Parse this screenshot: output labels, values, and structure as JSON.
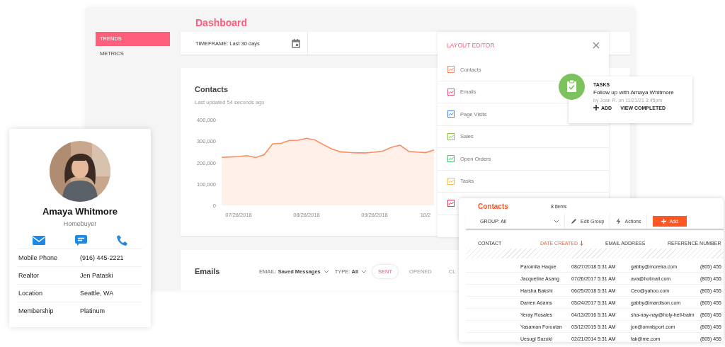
{
  "window": {
    "title": "Dashboard"
  },
  "sidebar": {
    "items": [
      {
        "label": "TRENDS",
        "selected": true
      },
      {
        "label": "METRICS",
        "selected": false
      }
    ]
  },
  "toolbar": {
    "timeframe": "TIMEFRAME: Last 30 days"
  },
  "contacts_card": {
    "title": "Contacts",
    "subtitle": "Last updated 54 seconds ago",
    "chart_data": {
      "type": "area",
      "categories": [
        null,
        null,
        "07/28/2018",
        null,
        null,
        null,
        null,
        null,
        null,
        null,
        "08/28/2018",
        null,
        null,
        null,
        null,
        null,
        null,
        null,
        "09/28/2018",
        null,
        null,
        null,
        null,
        null,
        "10/2",
        null
      ],
      "series": [
        {
          "color": "#ff8a5c",
          "values": [
            224000,
            226000,
            228000,
            232000,
            223000,
            236000,
            287000,
            290000,
            303000,
            304000,
            313000,
            305000,
            283000,
            263000,
            250000,
            247000,
            245000,
            245000,
            249000,
            254000,
            271000,
            281000,
            253000,
            249000,
            246000,
            259000
          ]
        }
      ],
      "ylim": [
        0,
        400000
      ],
      "yticks": [
        {
          "value": 0,
          "label": "0"
        },
        {
          "value": 100000,
          "label": "100,000"
        },
        {
          "value": 200000,
          "label": "200,000"
        },
        {
          "value": 300000,
          "label": "300,000"
        },
        {
          "value": 400000,
          "label": "400,000"
        }
      ]
    }
  },
  "emails_card": {
    "title": "Emails",
    "filters": [
      "EMAIL: **Saved Messages**",
      "TYPE: **All**"
    ],
    "tabs": [
      {
        "label": "SENT",
        "selected": true
      },
      {
        "label": "OPENED",
        "selected": false
      },
      {
        "label": "CL",
        "selected": false
      }
    ]
  },
  "layout_editor": {
    "title": "LAYOUT EDITOR",
    "items": [
      {
        "label": "Contacts",
        "color": "#ff8a65"
      },
      {
        "label": "Emails",
        "color": "#ef5370"
      },
      {
        "label": "Page Visits",
        "color": "#4a86e8"
      },
      {
        "label": "Sales",
        "color": "#8bc34a"
      },
      {
        "label": "Open Orders",
        "color": "#4cc36f"
      },
      {
        "label": "Tasks",
        "color": "#ffb74d"
      },
      {
        "color": "#e53950"
      }
    ]
  },
  "task_popup": {
    "title": "TASKS",
    "task": "Follow up with Amaya Whitmore",
    "meta": "by Joan R. on 11/21/21 3:45pm",
    "actions": [
      {
        "label": "ADD",
        "kind": "add"
      },
      {
        "label": "VIEW COMPLETED",
        "kind": "link"
      }
    ]
  },
  "profile_card": {
    "name": "Amaya Whitmore",
    "role": "Homebuyer",
    "fields": [
      {
        "label": "Mobile Phone",
        "value": "(916) 445-2221"
      },
      {
        "label": "Realtor",
        "value": "Jen Pataski"
      },
      {
        "label": "Location",
        "value": "Seattle, WA"
      },
      {
        "label": "Membership",
        "value": "Platinum"
      }
    ]
  },
  "contacts_table": {
    "title": "Contacts",
    "count": "8 items",
    "group": "GROUP: All",
    "actions": [
      {
        "label": "Edit Group",
        "kind": "edit"
      },
      {
        "label": "Actions",
        "kind": "bolt"
      }
    ],
    "add_button": "Add",
    "columns": [
      {
        "label": "CONTACT",
        "selected": false
      },
      {
        "label": "DATE CREATED",
        "selected": true
      },
      {
        "label": "EMAIL ADDRESS",
        "selected": false
      },
      {
        "label": "REFERENCE NUMBER",
        "selected": false
      }
    ],
    "rows": [
      [
        "Paromita Haque",
        "08/27/2018 5:31 AM",
        "gabby@moreira.com",
        "(805) 455"
      ],
      [
        "Jacqueline Asang",
        "07/26/2017 5:31 AM",
        "ava@hotmail.com",
        "(805) 455"
      ],
      [
        "Harsha Bakshi",
        "06/25/2018 5:31 AM",
        "Ceo@yahoo.com",
        "(805) 455"
      ],
      [
        "Darren Adams",
        "05/24/2017 5:31 AM",
        "gabby@mardison.com",
        "(805) 455"
      ],
      [
        "Yeray Rosales",
        "04/13/2016 5:31 AM",
        "sha-nay-nay@holy-hell-batm",
        "(805) 455"
      ],
      [
        "Yasaman Foroutan",
        "03/12/2015 5:31 AM",
        "jon@omnisport.com",
        "(805) 455"
      ],
      [
        "Uesugi Suzuki",
        "02/21/2014 5:31 AM",
        "fak@me.com",
        "(805) 455"
      ]
    ]
  }
}
